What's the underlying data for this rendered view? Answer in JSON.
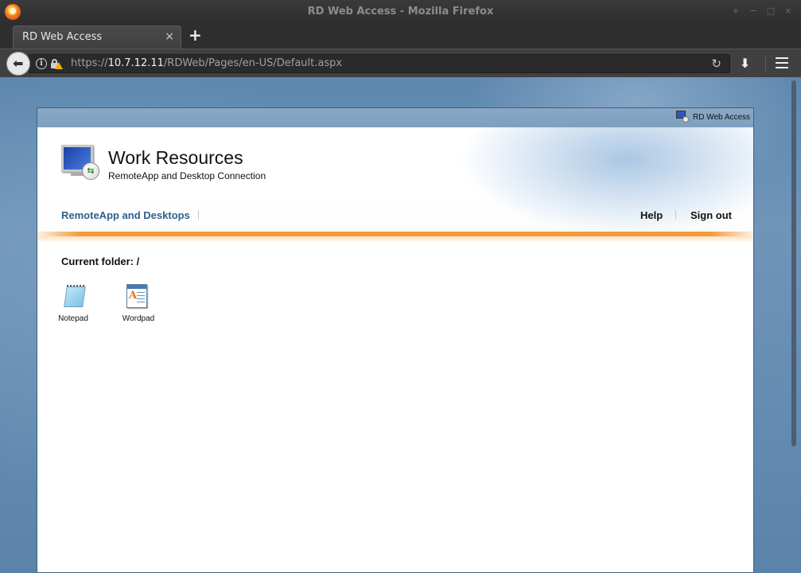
{
  "window": {
    "title": "RD Web Access - Mozilla Firefox",
    "controls": [
      "+",
      "−",
      "□",
      "×"
    ]
  },
  "tabs": [
    {
      "label": "RD Web Access",
      "close": "×"
    }
  ],
  "new_tab": "+",
  "nav": {
    "back": "⬅",
    "url_scheme": "https://",
    "url_host": "10.7.12.11",
    "url_path": "/RDWeb/Pages/en-US/Default.aspx",
    "reload": "↻",
    "download": "⬇",
    "info": "i"
  },
  "page": {
    "badge": "RD Web Access",
    "title": "Work Resources",
    "subtitle": "RemoteApp and Desktop Connection",
    "nav_left": "RemoteApp and Desktops",
    "help": "Help",
    "sign_out": "Sign out",
    "current_folder": "Current folder: /",
    "apps": [
      {
        "label": "Notepad",
        "icon": "notepad-icon"
      },
      {
        "label": "Wordpad",
        "icon": "wordpad-icon"
      }
    ]
  },
  "colors": {
    "accent_orange": "#f39a3a",
    "link_blue": "#2f5f8f",
    "topbar_blue": "#8aa8c6"
  }
}
